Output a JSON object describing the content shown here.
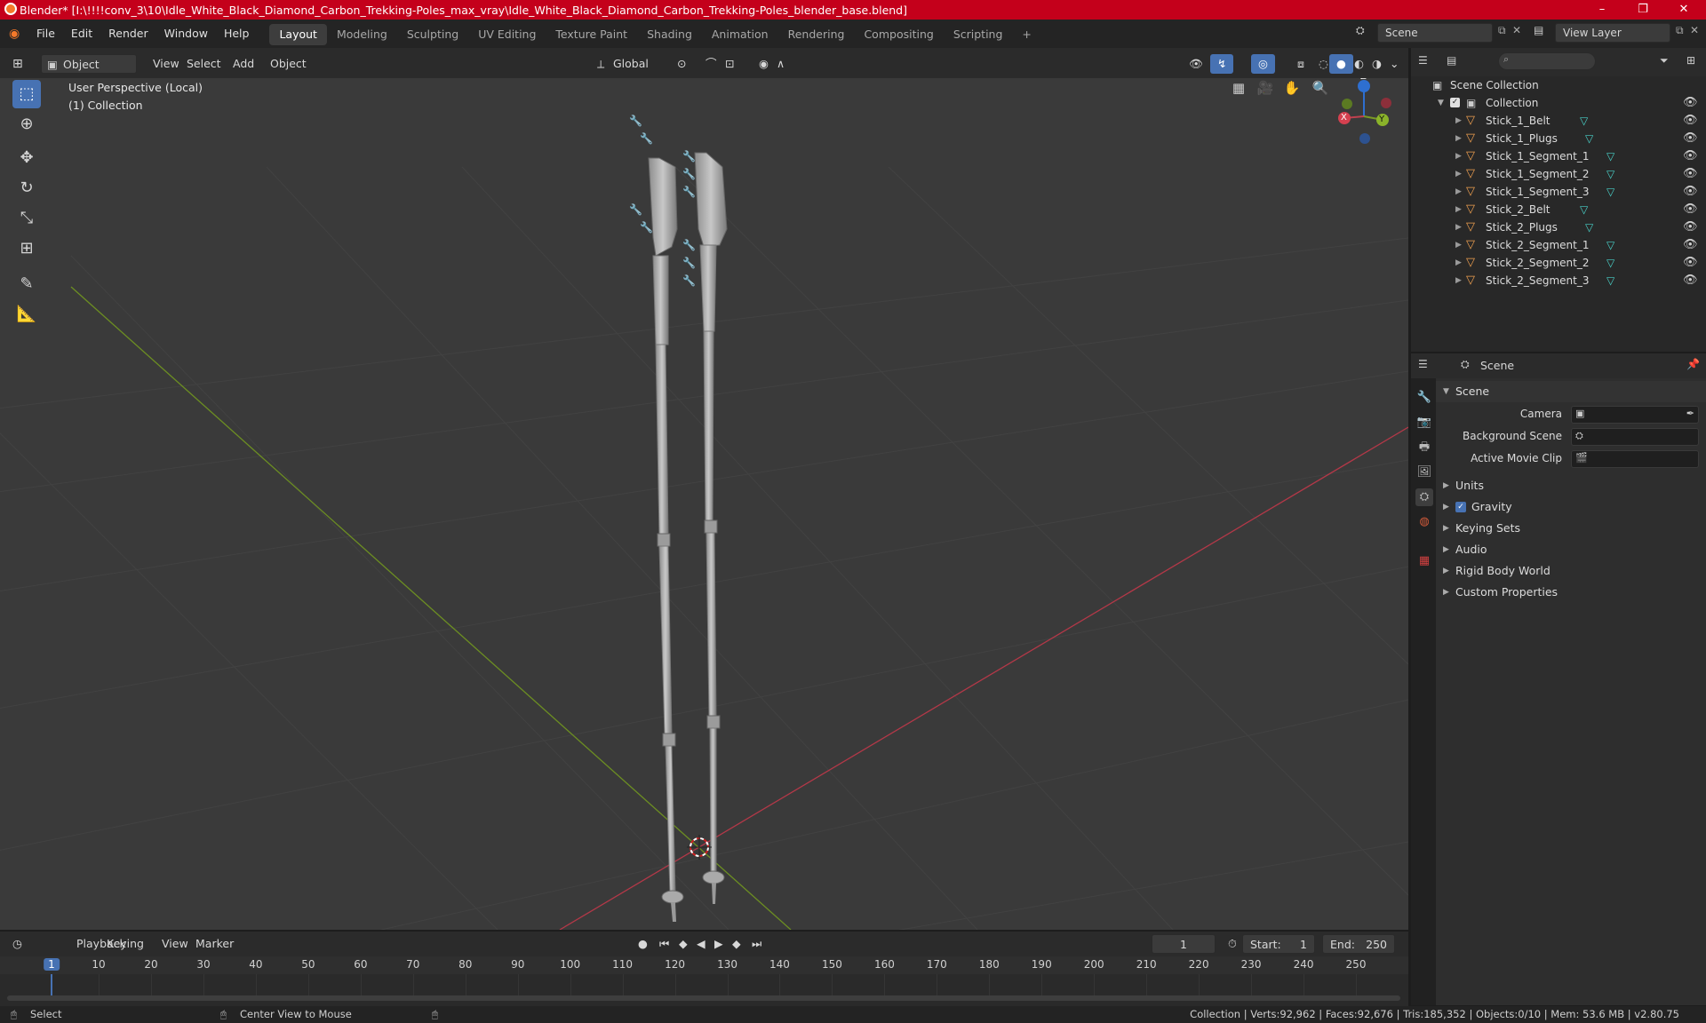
{
  "window": {
    "title": "Blender* [I:\\!!!!conv_3\\10\\Idle_White_Black_Diamond_Carbon_Trekking-Poles_max_vray\\Idle_White_Black_Diamond_Carbon_Trekking-Poles_blender_base.blend]",
    "min": "–",
    "max": "❐",
    "close": "✕"
  },
  "menu": [
    "File",
    "Edit",
    "Render",
    "Window",
    "Help"
  ],
  "workspaces": [
    "Layout",
    "Modeling",
    "Sculpting",
    "UV Editing",
    "Texture Paint",
    "Shading",
    "Animation",
    "Rendering",
    "Compositing",
    "Scripting"
  ],
  "add_workspace": "+",
  "scene_selector": "Scene",
  "view_layer": "View Layer",
  "viewport_header": {
    "mode": "Object Mode",
    "menus": [
      "View",
      "Select",
      "Add",
      "Object"
    ],
    "transform_orientation": "Global"
  },
  "viewport": {
    "perspective": "User Perspective (Local)",
    "collection": "(1) Collection",
    "gizmo": {
      "z": "Z",
      "y": "Y",
      "x": "X"
    },
    "colors": {
      "x_axis": "#c0414f",
      "y_axis": "#7a9a25",
      "z_axis": "#2e6fd0"
    }
  },
  "outliner": {
    "search_placeholder": "",
    "root": "Scene Collection",
    "collection": "Collection",
    "items": [
      "Stick_1_Belt",
      "Stick_1_Plugs",
      "Stick_1_Segment_1",
      "Stick_1_Segment_2",
      "Stick_1_Segment_3",
      "Stick_2_Belt",
      "Stick_2_Plugs",
      "Stick_2_Segment_1",
      "Stick_2_Segment_2",
      "Stick_2_Segment_3"
    ]
  },
  "properties": {
    "header": "Scene",
    "panel": "Scene",
    "fields": {
      "camera": "Camera",
      "background_scene": "Background Scene",
      "active_movie_clip": "Active Movie Clip"
    },
    "sections": [
      "Units",
      "Gravity",
      "Keying Sets",
      "Audio",
      "Rigid Body World",
      "Custom Properties"
    ]
  },
  "timeline": {
    "menus": [
      "Playback",
      "Keying",
      "View",
      "Marker"
    ],
    "current_frame": "1",
    "start_label": "Start:",
    "start": "1",
    "end_label": "End:",
    "end": "250",
    "ticks": [
      "1",
      "10",
      "20",
      "30",
      "40",
      "50",
      "60",
      "70",
      "80",
      "90",
      "100",
      "110",
      "120",
      "130",
      "140",
      "150",
      "160",
      "170",
      "180",
      "190",
      "200",
      "210",
      "220",
      "230",
      "240",
      "250"
    ]
  },
  "status": {
    "select": "Select",
    "center": "Center View to Mouse",
    "stats": "Collection | Verts:92,962 | Faces:92,676 | Tris:185,352 | Objects:0/10 | Mem: 53.6 MB | v2.80.75"
  }
}
